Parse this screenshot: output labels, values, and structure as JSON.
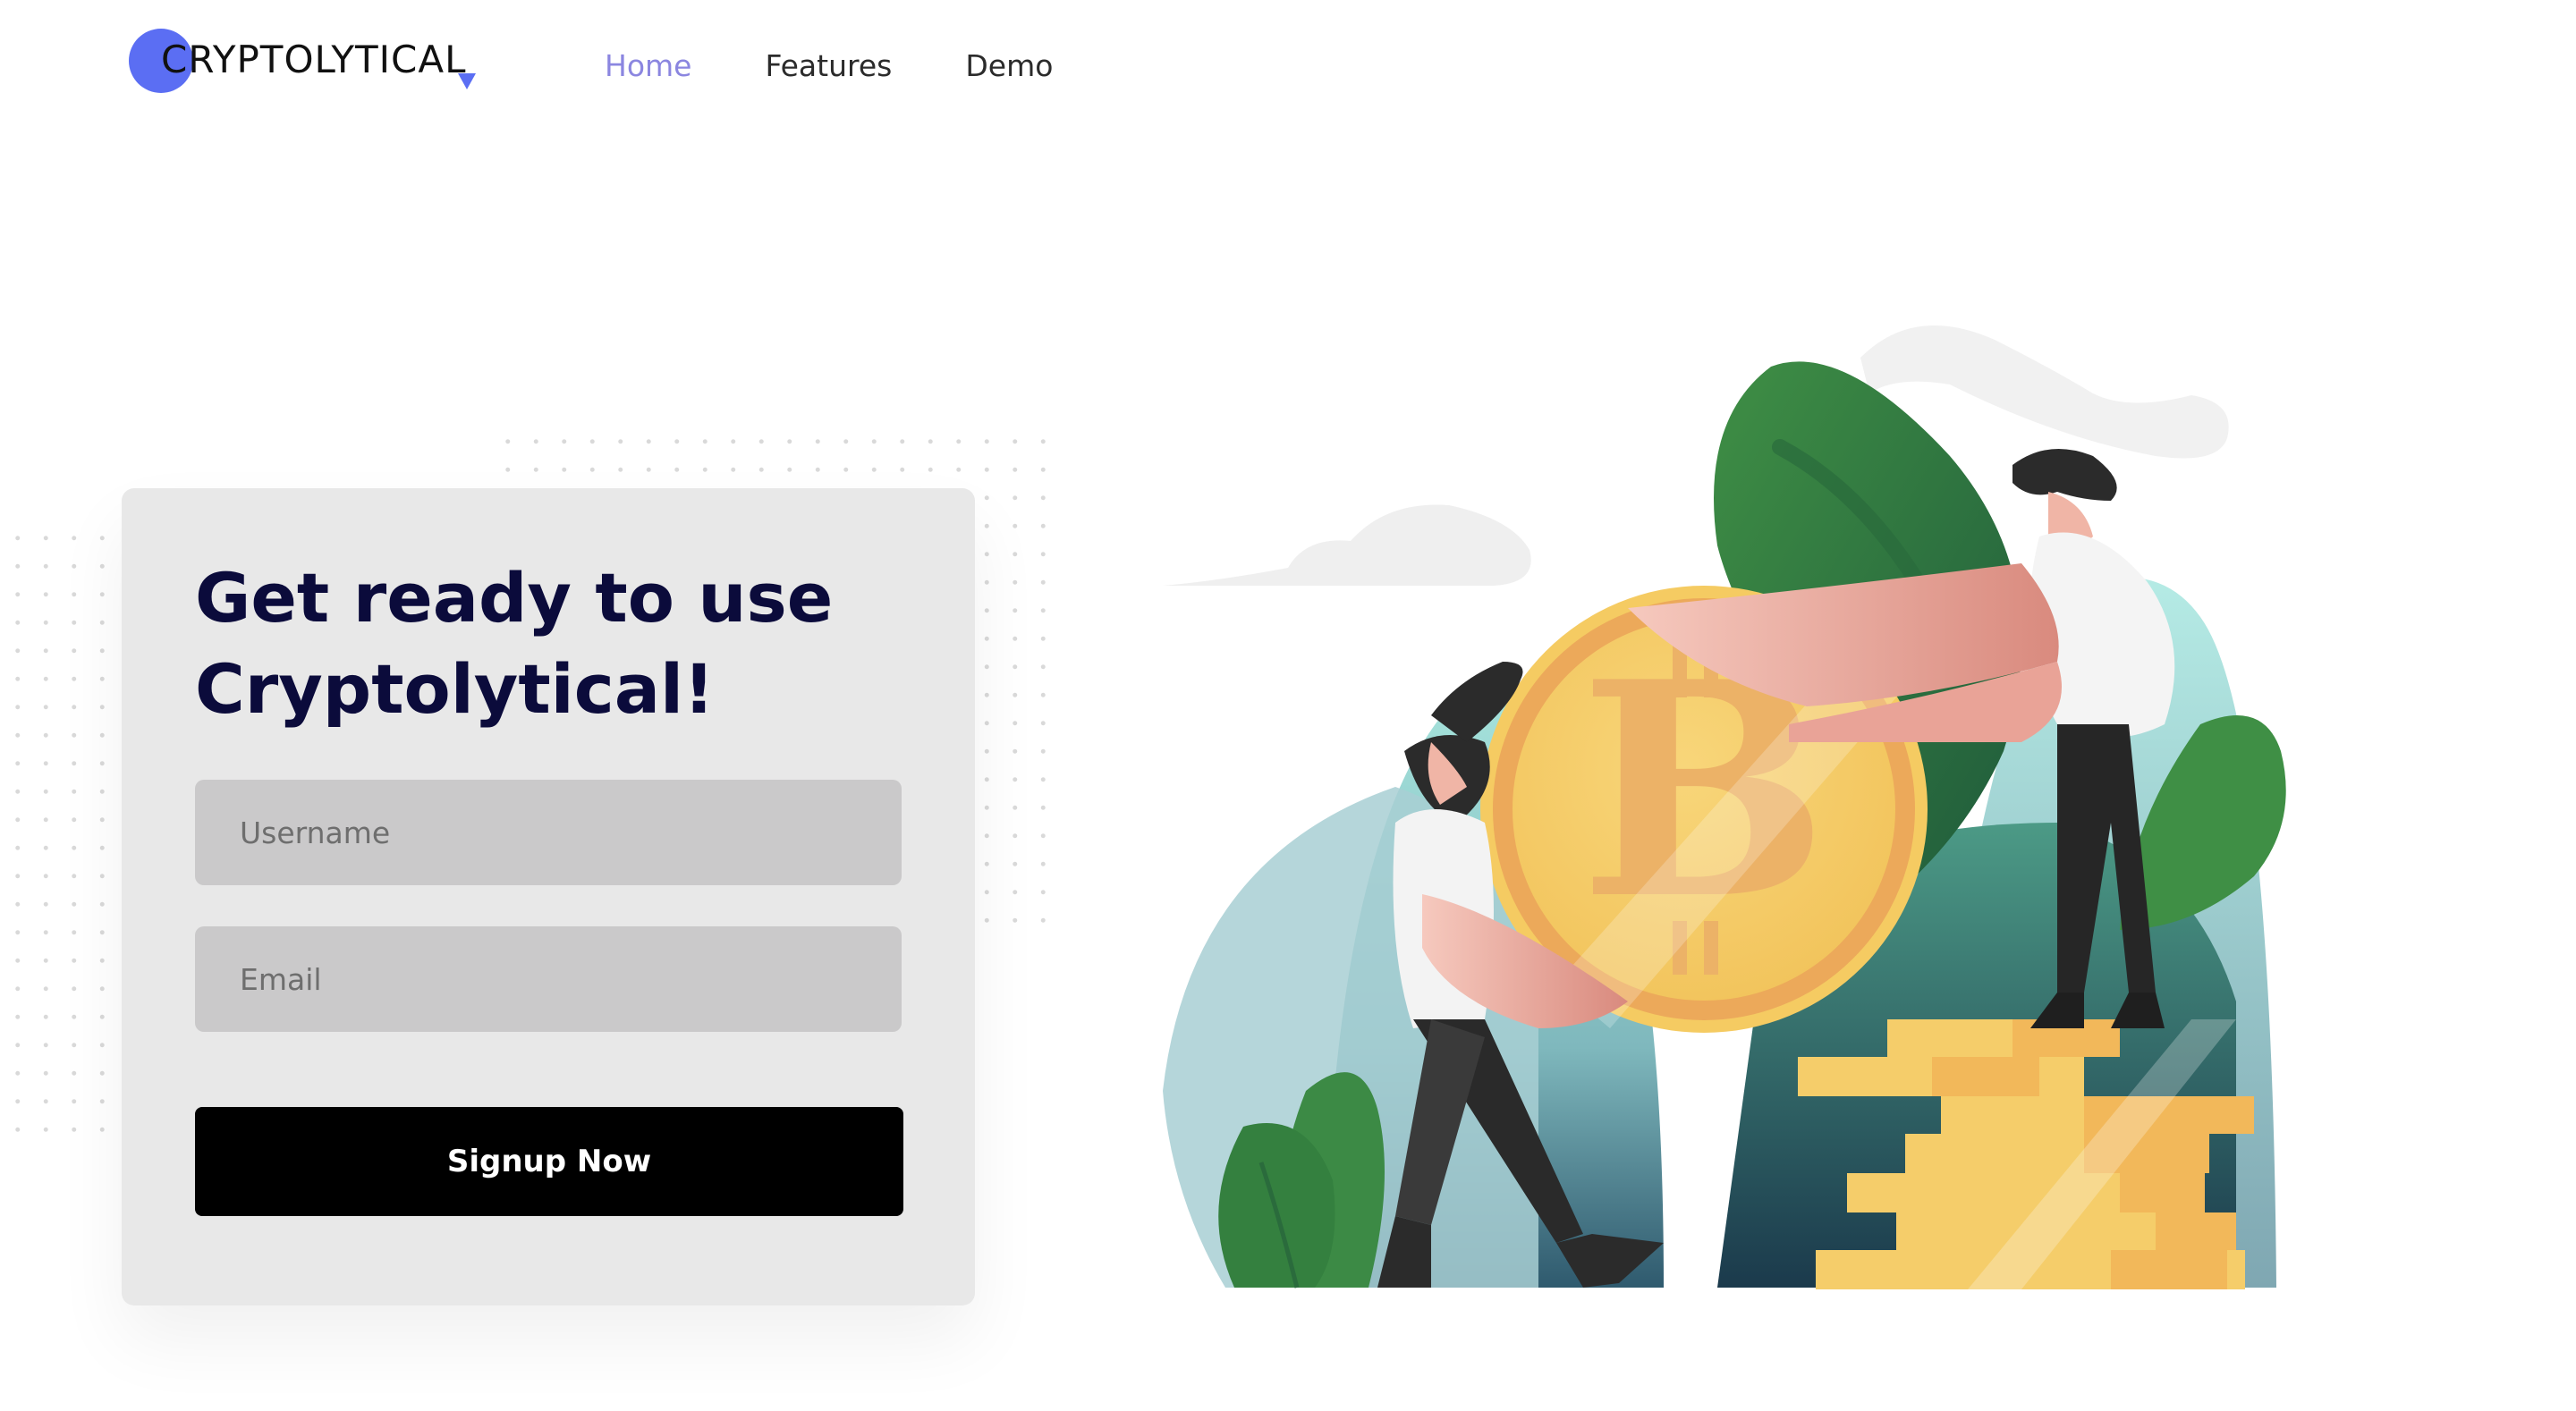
{
  "header": {
    "brand": "CRYPTOLYTICAL",
    "nav": [
      {
        "label": "Home",
        "active": true
      },
      {
        "label": "Features",
        "active": false
      },
      {
        "label": "Demo",
        "active": false
      }
    ]
  },
  "signup": {
    "title": "Get ready to use Cryptolytical!",
    "username_placeholder": "Username",
    "email_placeholder": "Email",
    "button_label": "Signup Now"
  },
  "colors": {
    "accent": "#5b6ef3",
    "nav_active": "#8b86e0",
    "title": "#0b0b3b",
    "card_bg": "#e8e8e8",
    "field_bg": "#cac9ca",
    "button_bg": "#000000"
  },
  "illustration": {
    "icons": [
      "bitcoin-coin-icon",
      "coin-stack-icon",
      "person-icon",
      "leaf-icon",
      "cloud-icon"
    ]
  }
}
